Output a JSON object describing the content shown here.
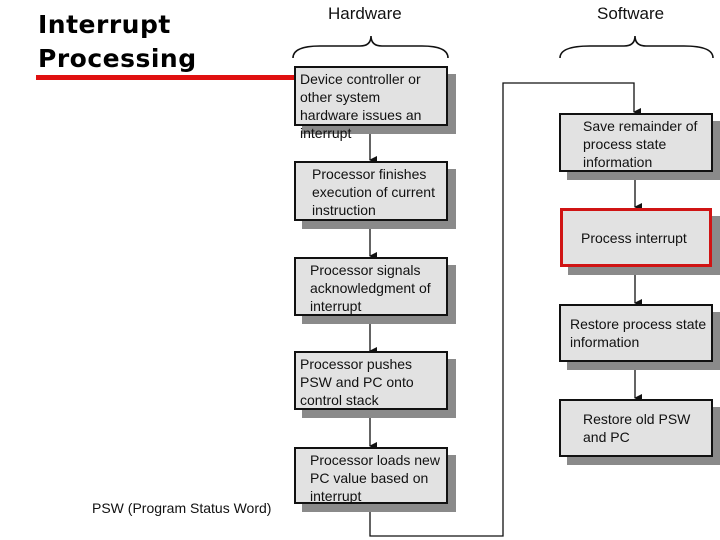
{
  "title": {
    "line1": "Interrupt",
    "line2": "Processing"
  },
  "accent_color": "#e01010",
  "columns": {
    "hardware": "Hardware",
    "software": "Software"
  },
  "hardware_steps": [
    {
      "text": "Device controller or other system hardware issues an interrupt"
    },
    {
      "text": "Processor finishes execution of current instruction"
    },
    {
      "text": "Processor signals acknowledgment of interrupt"
    },
    {
      "text": "Processor pushes PSW and PC onto control stack"
    },
    {
      "text": "Processor loads new PC value based on interrupt"
    }
  ],
  "software_steps": [
    {
      "text": "Save remainder of process state information"
    },
    {
      "text": "Process interrupt",
      "highlighted": true
    },
    {
      "text": "Restore process state information"
    },
    {
      "text": "Restore old PSW and PC"
    }
  ],
  "footnote": "PSW (Program Status Word)"
}
